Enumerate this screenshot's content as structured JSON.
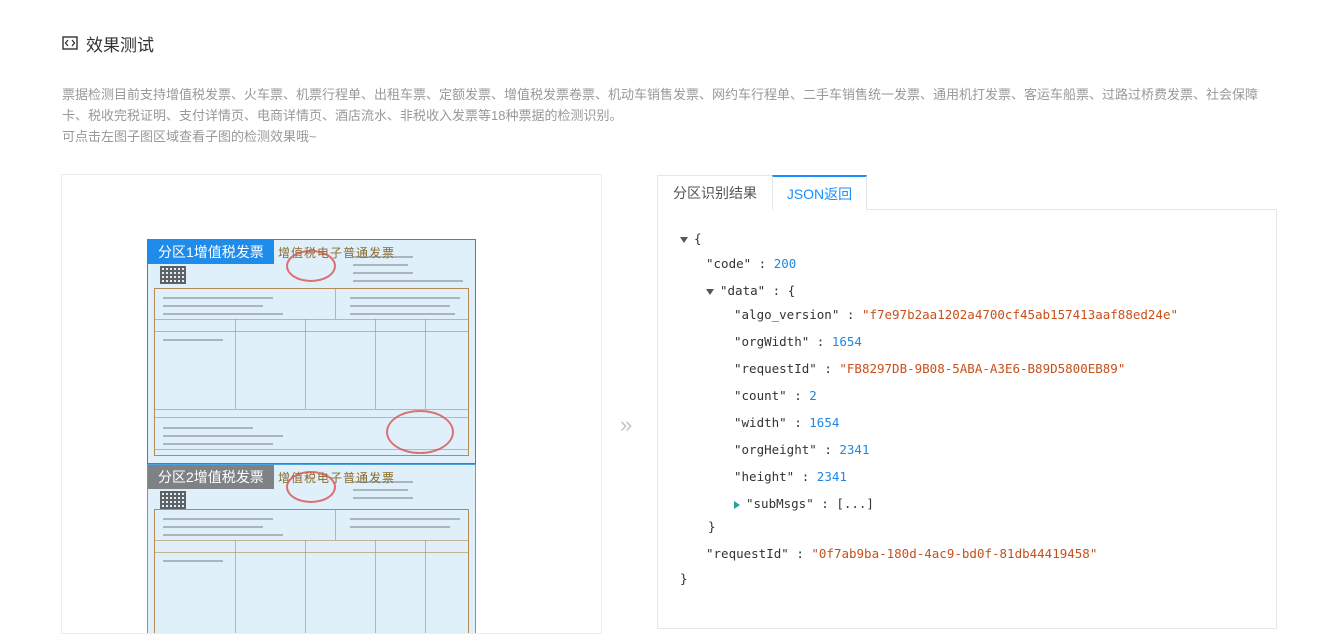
{
  "section": {
    "title": "效果测试",
    "icon": "code-icon"
  },
  "description": {
    "line1": "票据检测目前支持增值税发票、火车票、机票行程单、出租车票、定额发票、增值税发票卷票、机动车销售发票、网约车行程单、二手车销售统一发票、通用机打发票、客运车船票、过路过桥费发票、社会保障卡、税收完税证明、支付详情页、电商详情页、酒店流水、非税收入发票等18种票据的检测识别。",
    "line2": "可点击左图子图区域查看子图的检测效果哦~"
  },
  "preview": {
    "regions": [
      {
        "label": "分区1增值税发票",
        "color": "#e0474c",
        "doc_title": "增值税电子普通发票"
      },
      {
        "label": "分区2增值税发票",
        "color": "#4aa3df",
        "doc_title": "增值税电子普通发票"
      }
    ],
    "separator": "»"
  },
  "tabs": [
    {
      "label": "分区识别结果",
      "active": false
    },
    {
      "label": "JSON返回",
      "active": true
    }
  ],
  "json": {
    "open_brace": "{",
    "code_key": "\"code\"",
    "code_val": "200",
    "data_key": "\"data\"",
    "data_open": "{",
    "algo_key": "\"algo_version\"",
    "algo_val": "\"f7e97b2aa1202a4700cf45ab157413aaf88ed24e\"",
    "orgWidth_key": "\"orgWidth\"",
    "orgWidth_val": "1654",
    "requestId_key": "\"requestId\"",
    "requestId_val": "\"FB8297DB-9B08-5ABA-A3E6-B89D5800EB89\"",
    "count_key": "\"count\"",
    "count_val": "2",
    "width_key": "\"width\"",
    "width_val": "1654",
    "orgHeight_key": "\"orgHeight\"",
    "orgHeight_val": "2341",
    "height_key": "\"height\"",
    "height_val": "2341",
    "subMsgs_key": "\"subMsgs\"",
    "subMsgs_val": "[...]",
    "data_close": "}",
    "requestId2_key": "\"requestId\"",
    "requestId2_val": "\"0f7ab9ba-180d-4ac9-bd0f-81db44419458\"",
    "close_brace": "}"
  }
}
